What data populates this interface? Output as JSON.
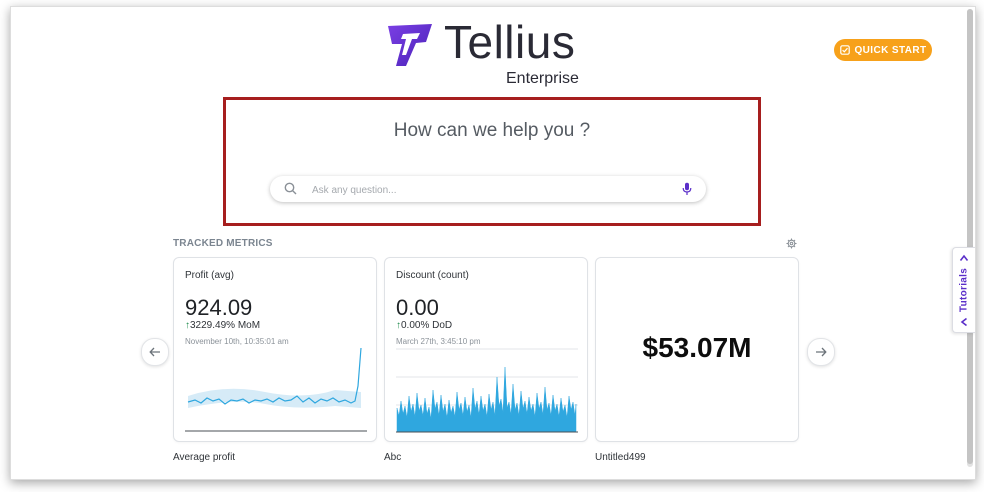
{
  "brand": {
    "name": "Tellius",
    "edition": "Enterprise"
  },
  "header": {
    "quick_start_label": "QUICK START"
  },
  "help": {
    "title": "How can we help you ?",
    "search_placeholder": "Ask any question...",
    "search_value": ""
  },
  "tracked_metrics": {
    "section_label": "TRACKED METRICS",
    "cards": [
      {
        "name": "Profit (avg)",
        "value": "924.09",
        "change": "3229.49% MoM",
        "change_direction": "up",
        "timestamp": "November 10th, 10:35:01 am",
        "caption": "Average profit"
      },
      {
        "name": "Discount (count)",
        "value": "0.00",
        "change": "0.00% DoD",
        "change_direction": "up",
        "timestamp": "March 27th, 3:45:10 pm",
        "caption": "Abc"
      },
      {
        "value": "$53.07M",
        "caption": "Untitled499"
      }
    ]
  },
  "side_tab": {
    "label": "Tutorials"
  },
  "colors": {
    "accent_purple": "#5b2fc9",
    "quick_start_orange": "#f7a11a",
    "highlight_border": "#a61e1e",
    "chart_line": "#2fa7df",
    "positive_green": "#1f8b4c"
  },
  "icons": [
    "tellius-logo-icon",
    "checklist-icon",
    "search-icon",
    "microphone-icon",
    "gear-icon",
    "arrow-left-icon",
    "arrow-right-icon",
    "chevron-up-icon"
  ]
}
